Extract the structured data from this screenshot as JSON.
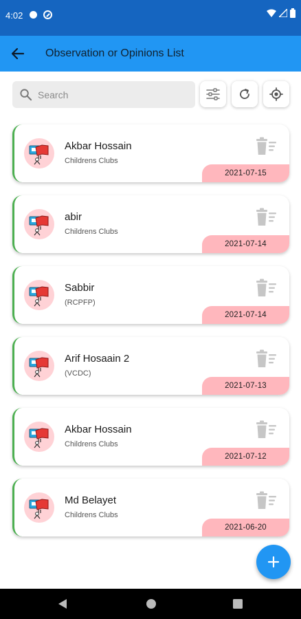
{
  "status_bar": {
    "time": "4:02"
  },
  "app_bar": {
    "title": "Observation or Opinions List"
  },
  "search": {
    "placeholder": "Search",
    "value": ""
  },
  "colors": {
    "app_bar": "#2196f3",
    "status_bar": "#1565c0",
    "accent_border": "#4caf50",
    "date_badge": "#ffb7bd",
    "avatar_bg": "#ffd2d6"
  },
  "icons": [
    "arrow-left",
    "search",
    "sliders",
    "refresh",
    "gps-target",
    "delete-list",
    "plus",
    "nav-back",
    "nav-home",
    "nav-recents"
  ],
  "items": [
    {
      "name": "Akbar Hossain",
      "subtitle": "Childrens Clubs",
      "date": "2021-07-15"
    },
    {
      "name": "abir",
      "subtitle": "Childrens Clubs",
      "date": "2021-07-14"
    },
    {
      "name": "Sabbir",
      "subtitle": "(RCPFP)",
      "date": "2021-07-14"
    },
    {
      "name": "Arif Hosaain 2",
      "subtitle": "(VCDC)",
      "date": "2021-07-13"
    },
    {
      "name": "Akbar Hossain",
      "subtitle": "Childrens Clubs",
      "date": "2021-07-12"
    },
    {
      "name": "Md Belayet",
      "subtitle": "Childrens Clubs",
      "date": "2021-06-20"
    }
  ]
}
